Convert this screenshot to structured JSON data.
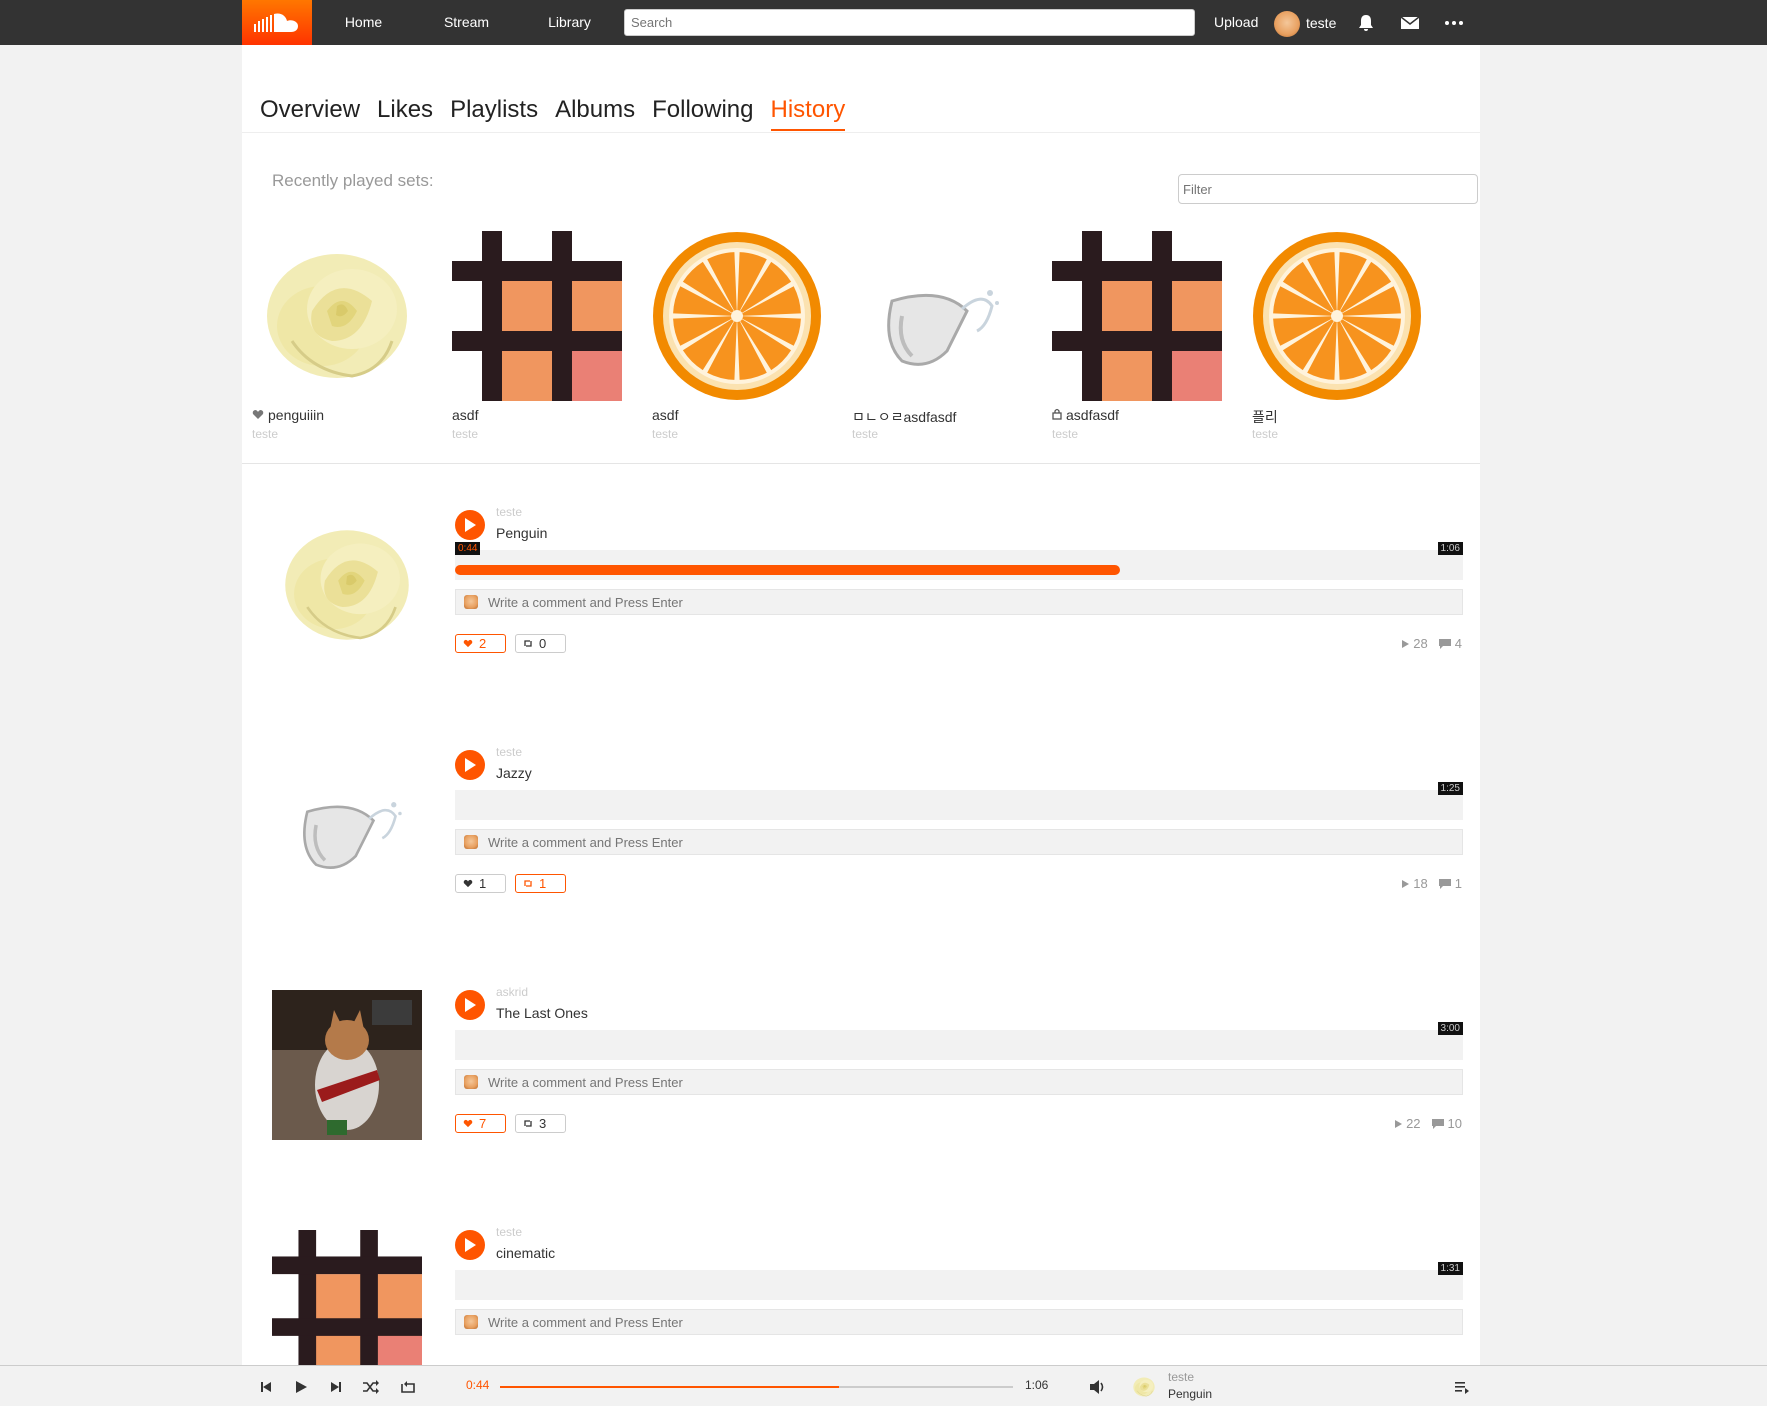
{
  "colors": {
    "accent": "#ff5500",
    "topbar": "#333333",
    "background": "#f2f2f2"
  },
  "topbar": {
    "logo_icon": "soundcloud-cloud-icon",
    "nav": [
      "Home",
      "Stream",
      "Library"
    ],
    "search_placeholder": "Search",
    "upload_label": "Upload",
    "username": "teste",
    "icons": [
      "bell-icon",
      "mail-icon",
      "more-icon"
    ]
  },
  "tabs": [
    "Overview",
    "Likes",
    "Playlists",
    "Albums",
    "Following",
    "History"
  ],
  "active_tab": "History",
  "recent": {
    "title": "Recently played sets:",
    "filter_placeholder": "Filter",
    "sets": [
      {
        "title": "penguiiin",
        "owner": "teste",
        "art": "rose",
        "icon": "heart-icon"
      },
      {
        "title": "asdf",
        "owner": "teste",
        "art": "grid",
        "icon": ""
      },
      {
        "title": "asdf",
        "owner": "teste",
        "art": "orange",
        "icon": ""
      },
      {
        "title": "ㅁㄴㅇㄹasdfasdf",
        "owner": "teste",
        "art": "glass",
        "icon": ""
      },
      {
        "title": "asdfasdf",
        "owner": "teste",
        "art": "grid",
        "icon": "lock-icon"
      },
      {
        "title": "플리",
        "owner": "teste",
        "art": "orange",
        "icon": ""
      }
    ]
  },
  "tracks": [
    {
      "user": "teste",
      "title": "Penguin",
      "art": "rose",
      "current": "0:44",
      "progress": 0.66,
      "duration": "1:06",
      "comment_placeholder": "Write a comment and Press Enter",
      "likes": "2",
      "liked": true,
      "reposts": "0",
      "reposted": false,
      "plays": "28",
      "comments": "4"
    },
    {
      "user": "teste",
      "title": "Jazzy",
      "art": "glass",
      "current": "",
      "progress": 0,
      "duration": "1:25",
      "comment_placeholder": "Write a comment and Press Enter",
      "likes": "1",
      "liked": false,
      "reposts": "1",
      "reposted": true,
      "plays": "18",
      "comments": "1"
    },
    {
      "user": "askrid",
      "title": "The Last Ones",
      "art": "cat",
      "current": "",
      "progress": 0,
      "duration": "3:00",
      "comment_placeholder": "Write a comment and Press Enter",
      "likes": "7",
      "liked": true,
      "reposts": "3",
      "reposted": false,
      "plays": "22",
      "comments": "10"
    },
    {
      "user": "teste",
      "title": "cinematic",
      "art": "grid",
      "current": "",
      "progress": 0,
      "duration": "1:31",
      "comment_placeholder": "Write a comment and Press Enter",
      "likes": "",
      "liked": false,
      "reposts": "",
      "reposted": false,
      "plays": "",
      "comments": ""
    }
  ],
  "player": {
    "current": "0:44",
    "duration": "1:06",
    "progress": 0.66,
    "user": "teste",
    "title": "Penguin",
    "controls": [
      "prev-icon",
      "play-icon",
      "next-icon",
      "shuffle-icon",
      "repeat-icon"
    ]
  }
}
